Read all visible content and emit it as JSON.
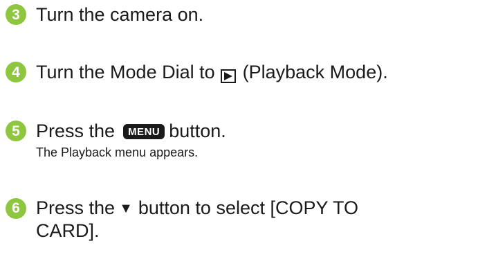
{
  "steps": [
    {
      "number": "3",
      "text": "Turn the camera on."
    },
    {
      "number": "4",
      "pre": "Turn the Mode Dial to",
      "icon": "play-icon",
      "post": "(Playback Mode)."
    },
    {
      "number": "5",
      "pre": "Press the",
      "key": "MENU",
      "post": "button.",
      "sub": "The Playback menu appears."
    },
    {
      "number": "6",
      "pre": "Press the",
      "arrow": "▼",
      "post": "button to select [COPY TO",
      "cont": "CARD]."
    }
  ],
  "colors": {
    "badge": "#8ec63f",
    "text": "#1a1a1a"
  }
}
